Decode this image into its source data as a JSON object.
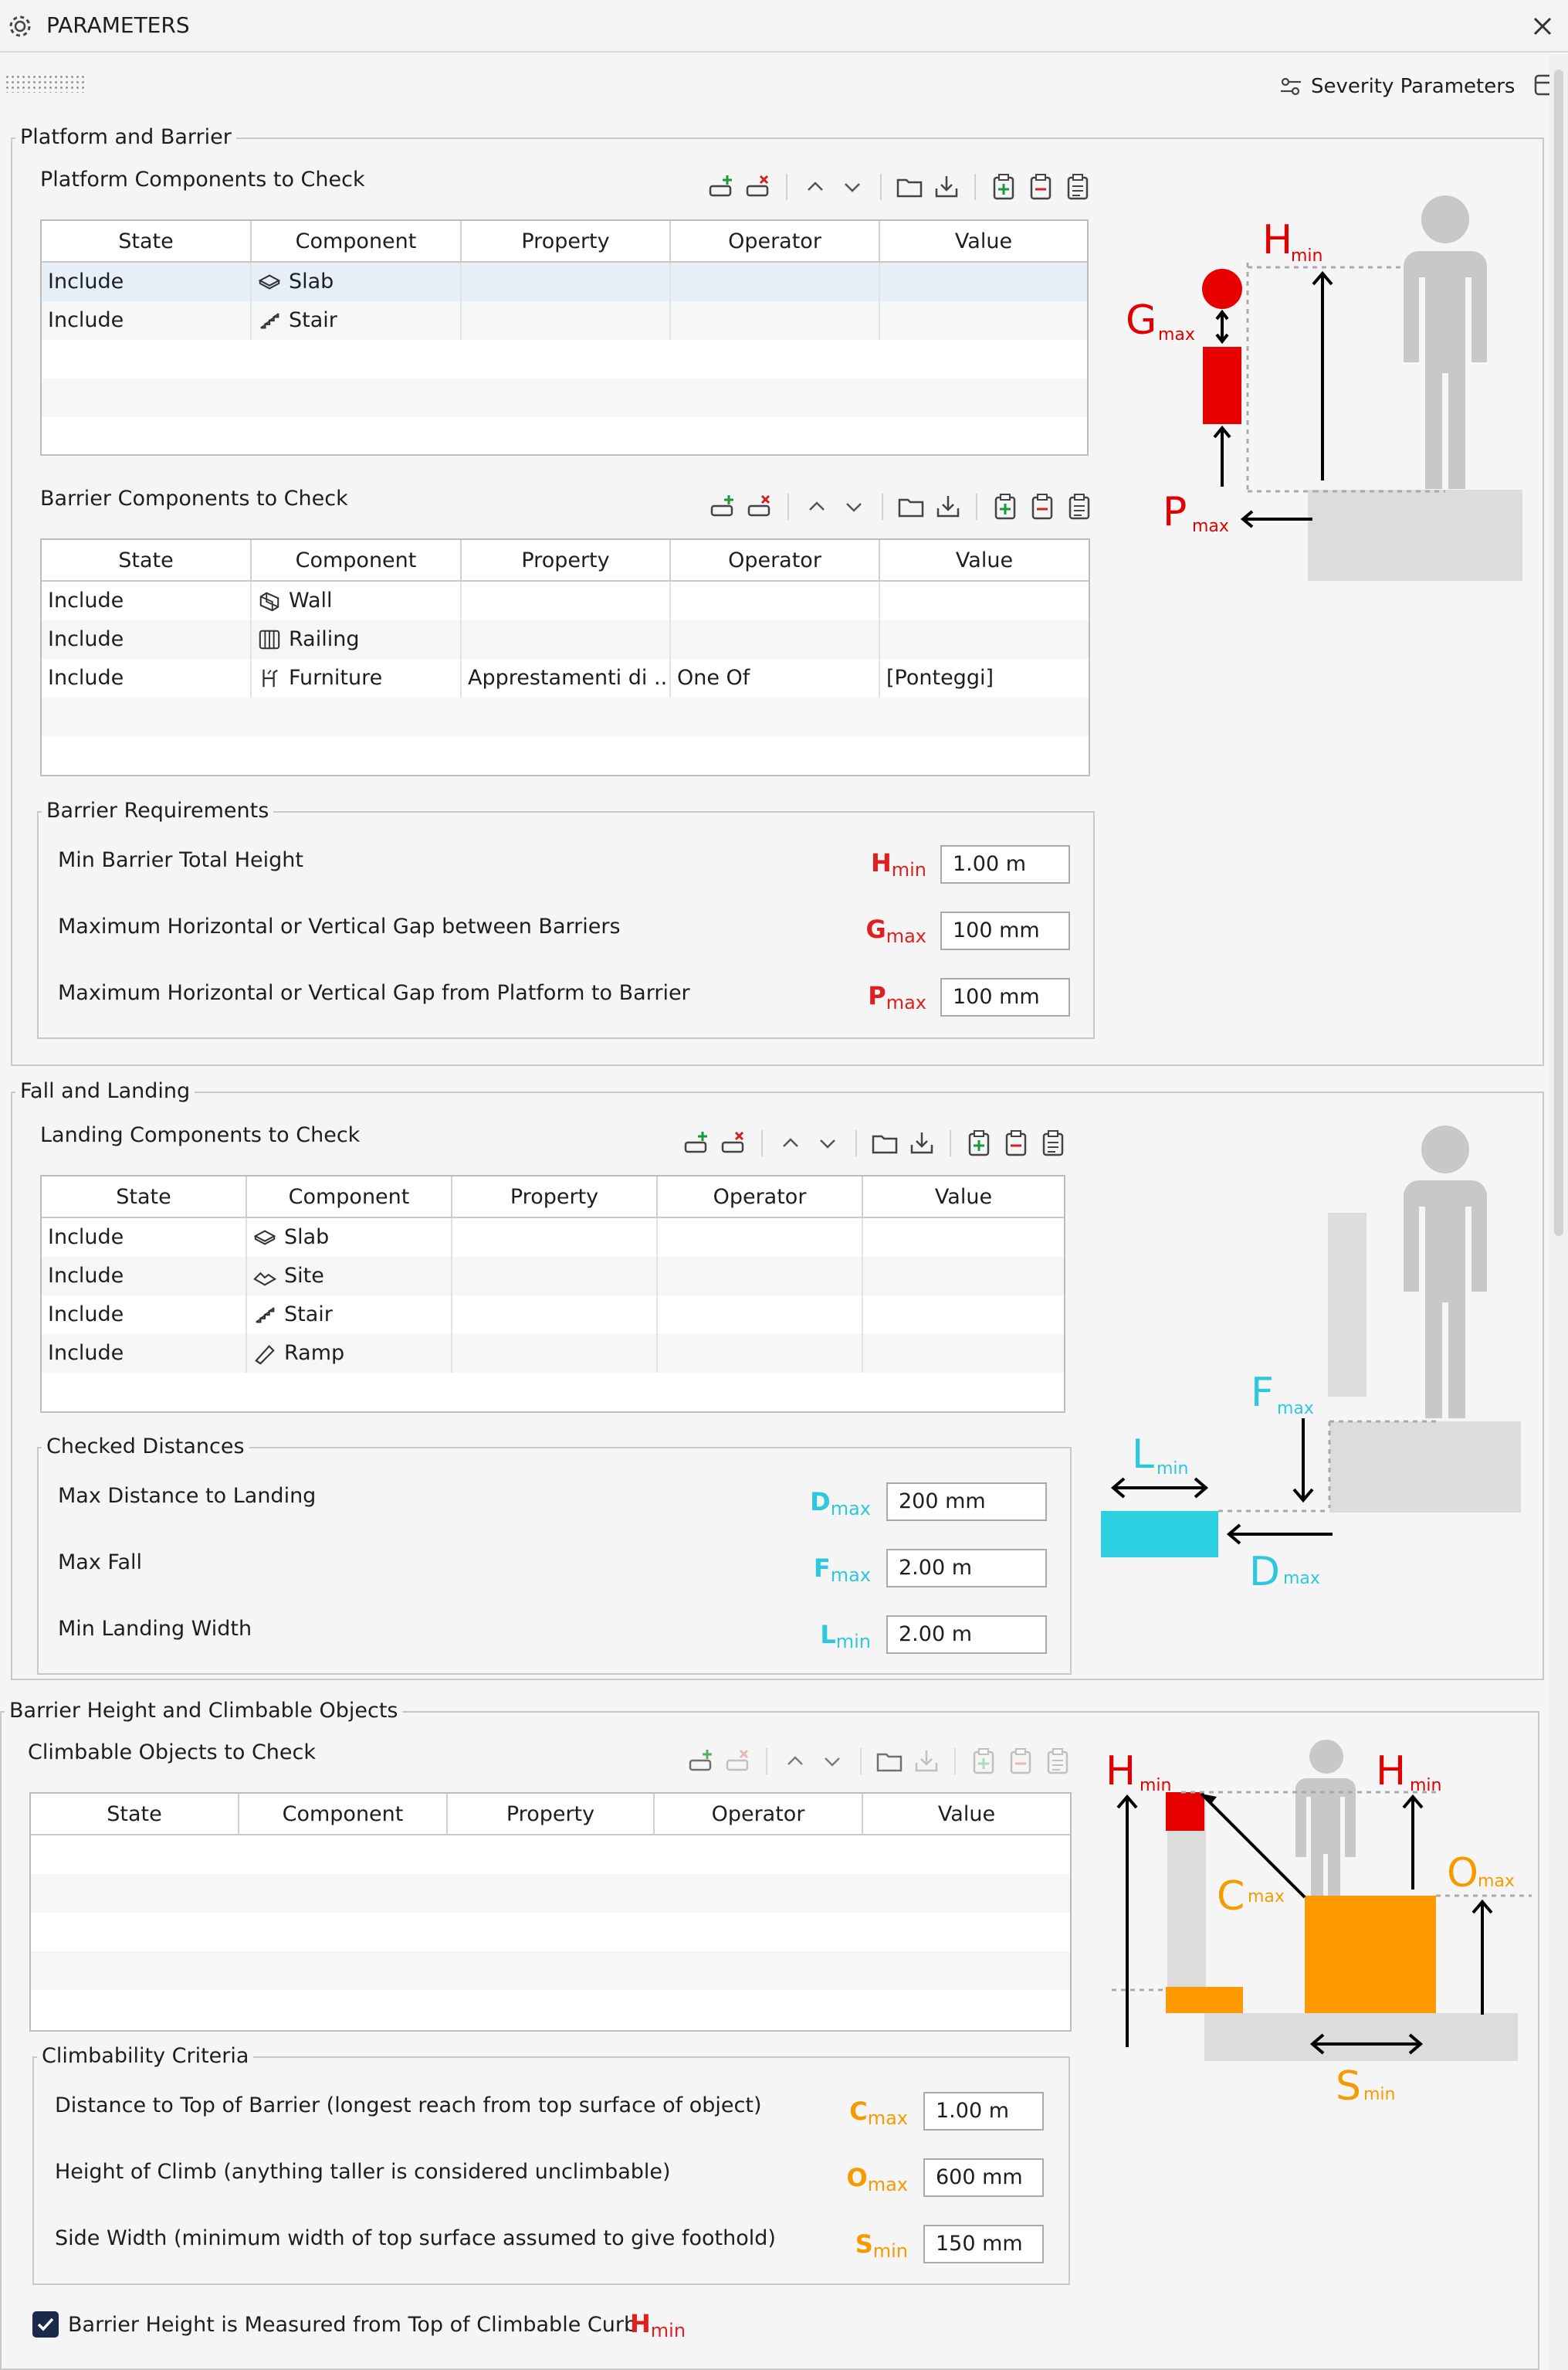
{
  "window": {
    "title": "PARAMETERS",
    "severity_link": "Severity Parameters"
  },
  "columns": [
    "State",
    "Component",
    "Property",
    "Operator",
    "Value"
  ],
  "platform": {
    "group_title": "Platform and Barrier",
    "platform_components": {
      "title": "Platform Components to Check",
      "rows": [
        {
          "state": "Include",
          "component": "Slab",
          "icon": "slab-icon",
          "property": "",
          "operator": "",
          "value": ""
        },
        {
          "state": "Include",
          "component": "Stair",
          "icon": "stair-icon",
          "property": "",
          "operator": "",
          "value": ""
        }
      ]
    },
    "barrier_components": {
      "title": "Barrier Components to Check",
      "rows": [
        {
          "state": "Include",
          "component": "Wall",
          "icon": "wall-icon",
          "property": "",
          "operator": "",
          "value": ""
        },
        {
          "state": "Include",
          "component": "Railing",
          "icon": "railing-icon",
          "property": "",
          "operator": "",
          "value": ""
        },
        {
          "state": "Include",
          "component": "Furniture",
          "icon": "furniture-icon",
          "property": "Apprestamenti di ...",
          "operator": "One Of",
          "value": "[Ponteggi]"
        }
      ]
    },
    "requirements": {
      "title": "Barrier Requirements",
      "items": [
        {
          "label": "Min Barrier Total Height",
          "sym": "H",
          "sub": "min",
          "value": "1.00 m"
        },
        {
          "label": "Maximum Horizontal or Vertical Gap between Barriers",
          "sym": "G",
          "sub": "max",
          "value": "100 mm"
        },
        {
          "label": "Maximum Horizontal or Vertical Gap from Platform to Barrier",
          "sym": "P",
          "sub": "max",
          "value": "100 mm"
        }
      ]
    },
    "diagram": {
      "h": "H",
      "h_sub": "min",
      "g": "G",
      "g_sub": "max",
      "p": "P",
      "p_sub": "max"
    }
  },
  "fall": {
    "group_title": "Fall and Landing",
    "landing_components": {
      "title": "Landing Components to Check",
      "rows": [
        {
          "state": "Include",
          "component": "Slab",
          "icon": "slab-icon",
          "property": "",
          "operator": "",
          "value": ""
        },
        {
          "state": "Include",
          "component": "Site",
          "icon": "site-icon",
          "property": "",
          "operator": "",
          "value": ""
        },
        {
          "state": "Include",
          "component": "Stair",
          "icon": "stair-icon",
          "property": "",
          "operator": "",
          "value": ""
        },
        {
          "state": "Include",
          "component": "Ramp",
          "icon": "ramp-icon",
          "property": "",
          "operator": "",
          "value": ""
        }
      ]
    },
    "distances": {
      "title": "Checked Distances",
      "items": [
        {
          "label": "Max Distance to Landing",
          "sym": "D",
          "sub": "max",
          "value": "200 mm"
        },
        {
          "label": "Max Fall",
          "sym": "F",
          "sub": "max",
          "value": "2.00 m"
        },
        {
          "label": "Min Landing Width",
          "sym": "L",
          "sub": "min",
          "value": "2.00 m"
        }
      ]
    },
    "diagram": {
      "f": "F",
      "f_sub": "max",
      "l": "L",
      "l_sub": "min",
      "d": "D",
      "d_sub": "max"
    }
  },
  "climb": {
    "group_title": "Barrier Height and Climbable Objects",
    "climbable_objects": {
      "title": "Climbable Objects to Check",
      "rows": []
    },
    "criteria": {
      "title": "Climbability Criteria",
      "items": [
        {
          "label": "Distance to Top of Barrier (longest reach from top surface of object)",
          "sym": "C",
          "sub": "max",
          "value": "1.00 m"
        },
        {
          "label": "Height of Climb (anything taller is considered unclimbable)",
          "sym": "O",
          "sub": "max",
          "value": "600 mm"
        },
        {
          "label": "Side Width (minimum width of top surface assumed to give foothold)",
          "sym": "S",
          "sub": "min",
          "value": "150 mm"
        }
      ]
    },
    "checkbox": {
      "label": "Barrier Height is Measured from Top of Climbable Curb",
      "sym": "H",
      "sub": "min",
      "checked": true
    },
    "diagram": {
      "h": "H",
      "h_sub": "min",
      "c": "C",
      "c_sub": "max",
      "o": "O",
      "o_sub": "max",
      "s": "S",
      "s_sub": "min"
    }
  },
  "colors": {
    "barrier": "#e60000",
    "landing": "#2dd0e0",
    "climb": "#ff9900",
    "figure": "#c8c8c8",
    "ground": "#dcdcdc"
  }
}
